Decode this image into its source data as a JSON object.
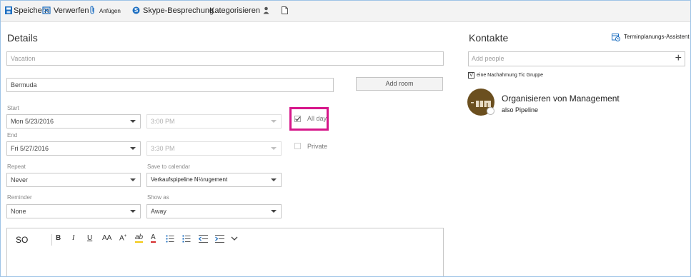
{
  "toolbar": {
    "save": "Speichern",
    "discard": "Verwerfen",
    "attach": "Anfügen",
    "skype": "Skype-Besprechung",
    "categorize": "Kategorisieren"
  },
  "details": {
    "heading": "Details",
    "title_placeholder": "Vacation",
    "location_value": "Bermuda",
    "add_room": "Add room",
    "start_label": "Start",
    "start_date": "Mon 5/23/2016",
    "start_time": "3:00 PM",
    "end_label": "End",
    "end_date": "Fri 5/27/2016",
    "end_time": "3:30 PM",
    "all_day_label": "All day",
    "all_day_checked": true,
    "private_label": "Private",
    "repeat_label": "Repeat",
    "repeat_value": "Never",
    "save_to_cal_label": "Save to calendar",
    "save_to_cal_value": "Verkaufspipeline  N½rugement",
    "reminder_label": "Reminder",
    "reminder_value": "None",
    "show_as_label": "Show as",
    "show_as_value": "Away"
  },
  "editor": {
    "font_name": "SO",
    "tools": [
      "bold",
      "italic",
      "underline",
      "font-size",
      "superscript",
      "highlight",
      "font-color",
      "bullets",
      "numbering",
      "outdent",
      "indent",
      "more"
    ]
  },
  "contacts": {
    "heading": "Kontakte",
    "scheduling": "Terminplanungs-Assistent",
    "add_people_placeholder": "Add people",
    "group_label": "eine Nachahmung Tic Gruppe",
    "group_icon_glyph": "V",
    "contact_name": "Organisieren von Management",
    "contact_sub": "also Pipeline"
  },
  "colors": {
    "accent": "#0078d7",
    "highlight": "#d6168a",
    "avatar_bg": "#6b4f1f"
  }
}
